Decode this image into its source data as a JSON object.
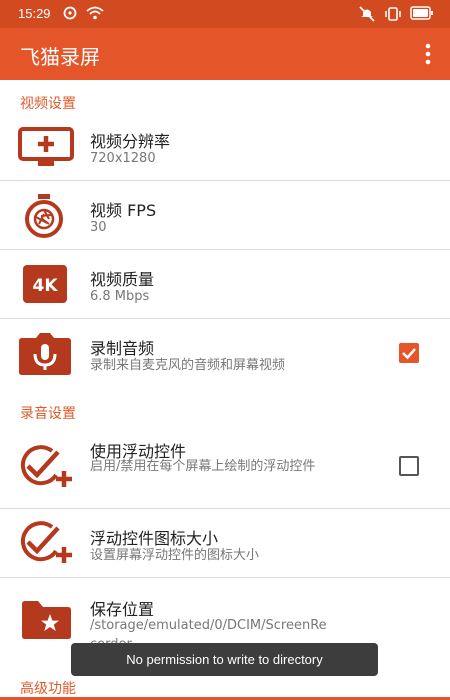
{
  "status_bar": {
    "time": "15:29",
    "icons": [
      "notification-icon",
      "wifi-icon",
      "mute-icon",
      "vibrate-icon",
      "battery-icon"
    ]
  },
  "app_bar": {
    "title": "飞猫录屏",
    "menu_icon": "more-vert-icon"
  },
  "sections": {
    "video": "视频设置",
    "audio": "录音设置",
    "advanced": "高级功能"
  },
  "settings": [
    {
      "title": "视频分辨率",
      "subtitle": "720x1280",
      "icon": "monitor-add-icon"
    },
    {
      "title": "视频 FPS",
      "subtitle": "30",
      "icon": "aperture-timer-icon"
    },
    {
      "title": "视频质量",
      "subtitle": "6.8 Mbps",
      "icon": "4k-badge-icon",
      "icon_text": "4K"
    },
    {
      "title": "录制音频",
      "subtitle": "录制来自麦克风的音频和屏幕视频",
      "icon": "microphone-icon",
      "checked": true
    },
    {
      "title": "使用浮动控件",
      "subtitle": "启用/禁用在每个屏幕上绘制的浮动控件",
      "icon": "check-plus-icon",
      "checked": false
    },
    {
      "title": "浮动控件图标大小",
      "subtitle": "设置屏幕浮动控件的图标大小",
      "icon": "check-plus-icon"
    },
    {
      "title": "保存位置",
      "subtitle": "/storage/emulated/0/DCIM/ScreenRecorder",
      "icon": "folder-star-icon"
    }
  ],
  "toast": "No permission to write to directory",
  "colors": {
    "accent": "#e5552a",
    "status_bar": "#d24a20",
    "toast_bg": "#3d3d3d"
  }
}
